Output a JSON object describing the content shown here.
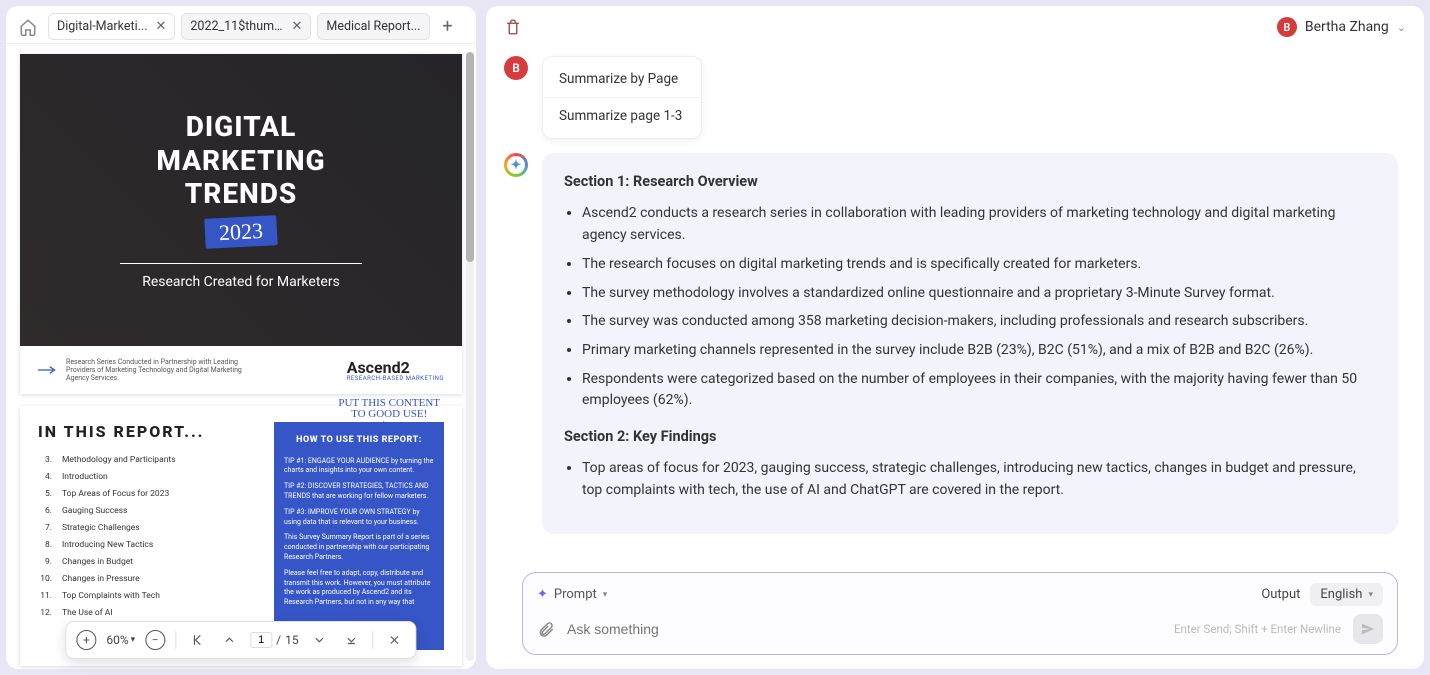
{
  "tabs": [
    {
      "label": "Digital-Marketi...",
      "active": true
    },
    {
      "label": "2022_11$thum...",
      "active": false
    },
    {
      "label": "Medical Report...",
      "active": false,
      "no_close": true
    }
  ],
  "user": {
    "initial": "B",
    "name": "Bertha Zhang"
  },
  "doc": {
    "hero": {
      "title_l1": "DIGITAL",
      "title_l2": "MARKETING",
      "title_l3": "TRENDS",
      "year": "2023",
      "subtitle": "Research Created for Marketers"
    },
    "footer_note": "Research Series Conducted in Partnership with Leading Providers of Marketing Technology and Digital Marketing Agency Services.",
    "brand": "Ascend2",
    "brand_sub": "RESEARCH-BASED MARKETING",
    "page2_title": "IN THIS REPORT...",
    "handwritten": "PUT THIS CONTENT\nTO GOOD USE!",
    "toc": [
      {
        "n": "3.",
        "t": "Methodology and Participants"
      },
      {
        "n": "4.",
        "t": "Introduction"
      },
      {
        "n": "5.",
        "t": "Top Areas of Focus for 2023"
      },
      {
        "n": "6.",
        "t": "Gauging Success"
      },
      {
        "n": "7.",
        "t": "Strategic Challenges"
      },
      {
        "n": "8.",
        "t": "Introducing New Tactics"
      },
      {
        "n": "9.",
        "t": "Changes in Budget"
      },
      {
        "n": "10.",
        "t": "Changes in Pressure"
      },
      {
        "n": "11.",
        "t": "Top Complaints with Tech"
      },
      {
        "n": "12.",
        "t": "The Use of AI"
      }
    ],
    "howto_title": "HOW TO USE THIS REPORT:",
    "howto": [
      "TIP #1: ENGAGE YOUR AUDIENCE by turning the charts and insights into your own content.",
      "TIP #2: DISCOVER STRATEGIES, TACTICS AND TRENDS that are working for fellow marketers.",
      "TIP #3: IMPROVE YOUR OWN STRATEGY by using data that is relevant to your business.",
      "This Survey Summary Report is part of a series conducted in partnership with our participating Research Partners.",
      "Please feel free to adapt, copy, distribute and transmit this work. However, you must attribute the work as produced by Ascend2 and its Research Partners, but not in any way that"
    ]
  },
  "toolbar": {
    "zoom": "60%",
    "page_current": "1",
    "page_total": "15"
  },
  "prompt_suggestions": [
    "Summarize by Page",
    "Summarize page 1-3"
  ],
  "response": {
    "section1_title": "Section 1: Research Overview",
    "section1": [
      "Ascend2 conducts a research series in collaboration with leading providers of marketing technology and digital marketing agency services.",
      "The research focuses on digital marketing trends and is specifically created for marketers.",
      "The survey methodology involves a standardized online questionnaire and a proprietary 3-Minute Survey format.",
      "The survey was conducted among 358 marketing decision-makers, including professionals and research subscribers.",
      "Primary marketing channels represented in the survey include B2B (23%), B2C (51%), and a mix of B2B and B2C (26%).",
      "Respondents were categorized based on the number of employees in their companies, with the majority having fewer than 50 employees (62%)."
    ],
    "section2_title": "Section 2: Key Findings",
    "section2": [
      "Top areas of focus for 2023, gauging success, strategic challenges, introducing new tactics, changes in budget and pressure, top complaints with tech, the use of AI and ChatGPT are covered in the report."
    ]
  },
  "input": {
    "prompt_label": "Prompt",
    "output_label": "Output",
    "language": "English",
    "placeholder": "Ask something",
    "hint": "Enter Send; Shift + Enter Newline"
  }
}
